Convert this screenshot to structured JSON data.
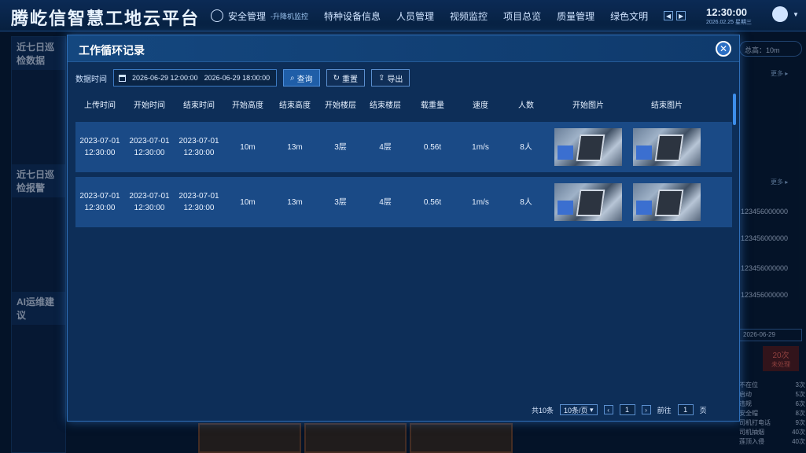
{
  "app": {
    "brand": "腾屹信智慧工地云平台",
    "nav": [
      {
        "label": "安全管理",
        "sub": "-升降机监控"
      },
      {
        "label": "特种设备信息"
      },
      {
        "label": "人员管理"
      },
      {
        "label": "视频监控"
      },
      {
        "label": "项目总览"
      },
      {
        "label": "质量管理"
      },
      {
        "label": "绿色文明"
      }
    ],
    "clock_time": "12:30:00",
    "clock_date": "2026.02.25 星期三"
  },
  "background": {
    "left_title_1": "近七日巡检数据",
    "left_title_2": "近七日巡检报警",
    "left_title_3": "AI运维建议",
    "right_chip": "总高：10m",
    "right_more": "更多 ▸",
    "right_numbers": [
      "123456000000",
      "123456000000",
      "123456000000",
      "123456000000"
    ],
    "right_date": "2026-06-29",
    "right_badge_value": "20次",
    "right_badge_label": "未处理",
    "right_stats": [
      {
        "label": "不在位",
        "value": "3次"
      },
      {
        "label": "启动",
        "value": "5次"
      },
      {
        "label": "违规",
        "value": "6次"
      },
      {
        "label": "安全帽",
        "value": "8次"
      },
      {
        "label": "司机打电话",
        "value": "9次"
      },
      {
        "label": "司机抽烟",
        "value": "40次"
      },
      {
        "label": "莲顶入侵",
        "value": "40次"
      }
    ]
  },
  "modal": {
    "title": "工作循环记录",
    "filter_label": "数据时间",
    "date_start": "2026-06-29 12:00:00",
    "date_end": "2026-06-29 18:00:00",
    "btn_query": "查询",
    "btn_reset": "重置",
    "btn_export": "导出",
    "columns": [
      "上传时间",
      "开始时间",
      "结束时间",
      "开始高度",
      "结束高度",
      "开始楼层",
      "结束楼层",
      "载重量",
      "速度",
      "人数",
      "开始图片",
      "结束图片"
    ],
    "rows": [
      {
        "upload_date": "2023-07-01",
        "upload_time": "12:30:00",
        "start_date": "2023-07-01",
        "start_time": "12:30:00",
        "end_date": "2023-07-01",
        "end_time": "12:30:00",
        "start_height": "10m",
        "end_height": "13m",
        "start_floor": "3层",
        "end_floor": "4层",
        "load": "0.56t",
        "speed": "1m/s",
        "people": "8人"
      },
      {
        "upload_date": "2023-07-01",
        "upload_time": "12:30:00",
        "start_date": "2023-07-01",
        "start_time": "12:30:00",
        "end_date": "2023-07-01",
        "end_time": "12:30:00",
        "start_height": "10m",
        "end_height": "13m",
        "start_floor": "3层",
        "end_floor": "4层",
        "load": "0.56t",
        "speed": "1m/s",
        "people": "8人"
      }
    ],
    "pager": {
      "total": "共10条",
      "page_size": "10条/页",
      "current": "1",
      "goto_label": "前往",
      "goto_value": "1",
      "page_unit": "页"
    }
  }
}
